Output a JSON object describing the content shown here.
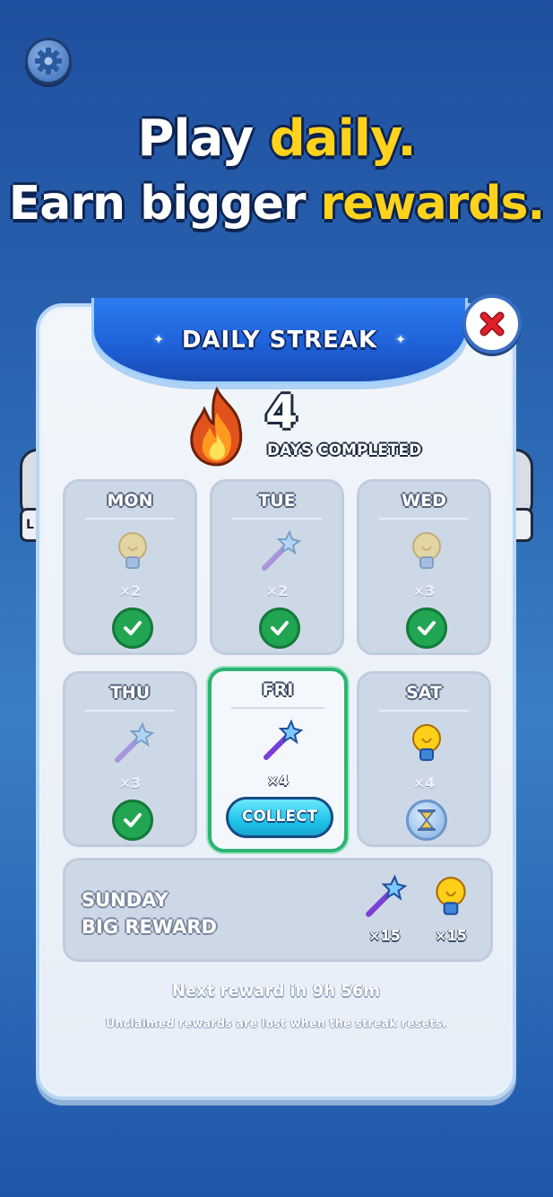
{
  "headline": {
    "line1_prefix": "Play ",
    "line1_highlight": "daily.",
    "line2_prefix": "Earn bigger ",
    "line2_highlight": "rewards."
  },
  "side_tab_left": "L",
  "dialog": {
    "title": "DAILY STREAK",
    "streak_count": "4",
    "streak_label": "DAYS COMPLETED",
    "days": [
      {
        "day": "MON",
        "item": "lightbulb-icon",
        "qty": "×2",
        "status": "completed"
      },
      {
        "day": "TUE",
        "item": "magic-wand-icon",
        "qty": "×2",
        "status": "completed"
      },
      {
        "day": "WED",
        "item": "lightbulb-icon",
        "qty": "×3",
        "status": "completed"
      },
      {
        "day": "THU",
        "item": "magic-wand-icon",
        "qty": "×3",
        "status": "completed"
      },
      {
        "day": "FRI",
        "item": "magic-wand-icon",
        "qty": "×4",
        "status": "collectable"
      },
      {
        "day": "SAT",
        "item": "lightbulb-icon",
        "qty": "×4",
        "status": "locked"
      }
    ],
    "collect_label": "COLLECT",
    "sunday": {
      "line1": "SUNDAY",
      "line2": "BIG REWARD",
      "rewards": [
        {
          "item": "magic-wand-icon",
          "qty": "×15"
        },
        {
          "item": "lightbulb-icon",
          "qty": "×15"
        }
      ]
    },
    "next_reward": "Next reward in 9h 56m",
    "warning": "Unclaimed rewards are lost when the streak resets."
  },
  "colors": {
    "background": "#2b67b4",
    "highlight": "#ffd21c",
    "check": "#21a552",
    "collect": "#1ec4e8",
    "close_x": "#e0202a"
  }
}
